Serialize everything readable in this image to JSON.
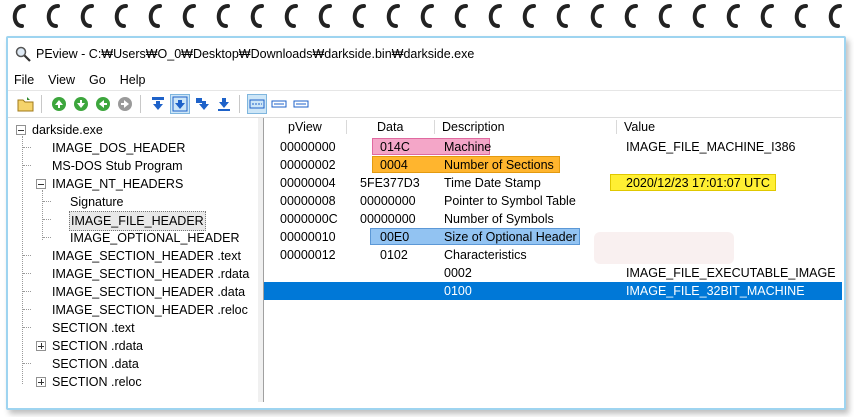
{
  "colors": {
    "pink_highlight": "#f4a6c8",
    "orange_highlight": "#ffb52e",
    "yellow_highlight": "#ffef33",
    "blue_highlight": "#92c3f2",
    "selection": "#0078d7"
  },
  "window": {
    "title": "PEview - C:₩Users₩O_0₩Desktop₩Downloads₩darkside.bin₩darkside.exe",
    "icon": "magnifier-icon"
  },
  "menu": [
    "File",
    "View",
    "Go",
    "Help"
  ],
  "toolbar": {
    "icons": [
      "open-file-icon",
      "back-icon",
      "forward-icon",
      "up-icon",
      "next-icon",
      "byte-view-icon",
      "word-view-icon",
      "dword-view-icon",
      "qword-view-icon",
      "details-view-icon",
      "list-view-icon",
      "small-view-icon"
    ]
  },
  "tree": {
    "root": "darkside.exe",
    "items": [
      "IMAGE_DOS_HEADER",
      "MS-DOS Stub Program",
      "IMAGE_NT_HEADERS",
      "Signature",
      "IMAGE_FILE_HEADER",
      "IMAGE_OPTIONAL_HEADER",
      "IMAGE_SECTION_HEADER .text",
      "IMAGE_SECTION_HEADER .rdata",
      "IMAGE_SECTION_HEADER .data",
      "IMAGE_SECTION_HEADER .reloc",
      "SECTION .text",
      "SECTION .rdata",
      "SECTION .data",
      "SECTION .reloc"
    ]
  },
  "table": {
    "columns": [
      "pView",
      "Data",
      "Description",
      "Value"
    ],
    "rows": [
      {
        "pview": "00000000",
        "data": "014C",
        "desc": "Machine",
        "value": "IMAGE_FILE_MACHINE_I386"
      },
      {
        "pview": "00000002",
        "data": "0004",
        "desc": "Number of Sections",
        "value": ""
      },
      {
        "pview": "00000004",
        "data": "5FE377D3",
        "desc": "Time Date Stamp",
        "value": "2020/12/23  17:01:07 UTC"
      },
      {
        "pview": "00000008",
        "data": "00000000",
        "desc": "Pointer to Symbol Table",
        "value": ""
      },
      {
        "pview": "0000000C",
        "data": "00000000",
        "desc": "Number of Symbols",
        "value": ""
      },
      {
        "pview": "00000010",
        "data": "00E0",
        "desc": "Size of Optional Header",
        "value": ""
      },
      {
        "pview": "00000012",
        "data": "0102",
        "desc": "Characteristics",
        "value": ""
      },
      {
        "pview": "",
        "data": "",
        "desc": "0002",
        "value": "IMAGE_FILE_EXECUTABLE_IMAGE"
      },
      {
        "pview": "",
        "data": "",
        "desc": "0100",
        "value": "IMAGE_FILE_32BIT_MACHINE"
      }
    ]
  }
}
